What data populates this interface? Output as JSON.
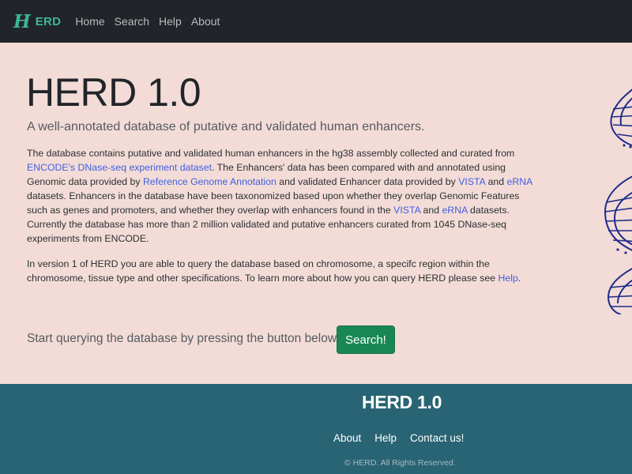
{
  "nav": {
    "brand_mark": "H",
    "brand_text": "ERD",
    "links": [
      "Home",
      "Search",
      "Help",
      "About"
    ]
  },
  "hero": {
    "title": "HERD 1.0",
    "lead": "A well-annotated database of putative and validated human enhancers.",
    "p1": {
      "t1": "The database contains putative and validated human enhancers in the hg38 assembly collected and curated from ",
      "l1": "ENCODE's DNase-seq experiment dataset",
      "t2": ". The Enhancers' data has been compared with and annotated using Genomic data provided by ",
      "l2": "Reference Genome Annotation",
      "t3": " and validated Enhancer data provided by ",
      "l3": "VISTA",
      "t4": " and ",
      "l4": "eRNA",
      "t5": " datasets. Enhancers in the database have been taxonomized based upon whether they overlap Genomic Features such as genes and promoters, and whether they overlap with enhancers found in the ",
      "l5": "VISTA",
      "t6": " and ",
      "l6": "eRNA",
      "t7": " datasets. Currently the database has more than 2 million validated and putative enhancers curated from 1045 DNase-seq experiments from ENCODE."
    },
    "p2": {
      "t1": "In version 1 of HERD you are able to query the database based on chromosome, a specifc region within the chromosome, tissue type and other specifications. To learn more about how you can query HERD please see ",
      "l1": "Help",
      "t2": "."
    },
    "cta_text": "Start querying the database by pressing the button below:",
    "cta_button": "Search!"
  },
  "footer": {
    "title": "HERD 1.0",
    "links": [
      "About",
      "Help",
      "Contact us!"
    ],
    "copyright": "© HERD. All Rights Reserved."
  },
  "colors": {
    "navbar": "#212529",
    "brand": "#3fb59a",
    "hero_bg": "#f3dcd7",
    "link": "#3f5fe0",
    "button": "#198754",
    "footer_bg": "#286474"
  },
  "icons": {
    "dna": "dna-helix-illustration"
  }
}
